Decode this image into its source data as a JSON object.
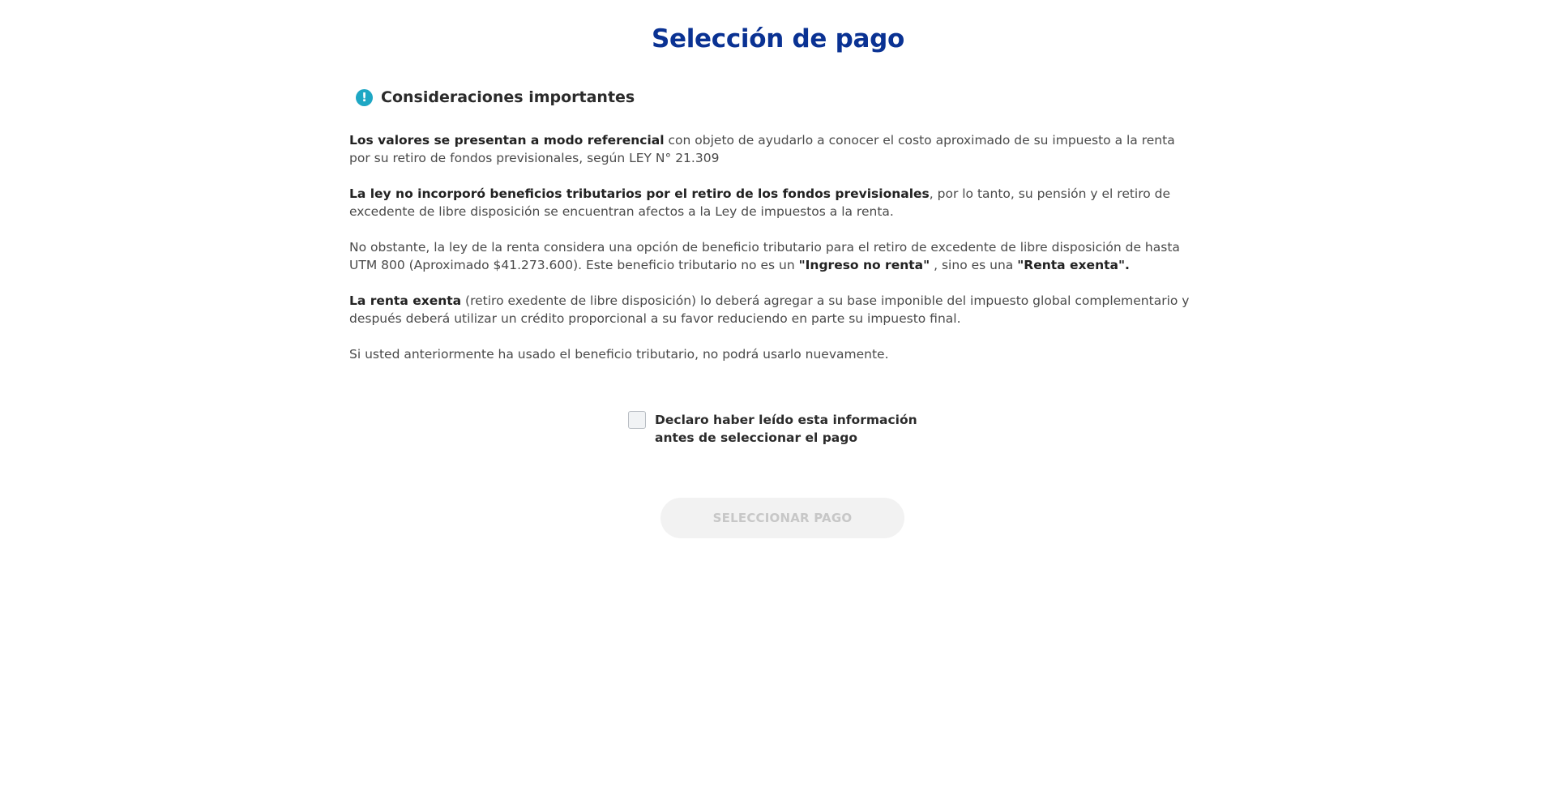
{
  "page": {
    "title": "Selección de pago"
  },
  "notice": {
    "icon": "info-icon",
    "icon_glyph": "!",
    "title": "Consideraciones importantes",
    "accent_color": "#1ea7c4",
    "paragraphs": [
      {
        "bold_1": "Los valores se presentan a modo referencial",
        "text_1": " con objeto de ayudarlo a conocer el costo aproximado de su impuesto a la renta por su retiro de fondos previsionales, según LEY N° 21.309"
      },
      {
        "bold_1": "La ley no incorporó beneficios tributarios por el retiro de los fondos previsionales",
        "text_1": ", por lo tanto, su pensión y el retiro de excedente de libre disposición se encuentran afectos a la Ley de impuestos a la renta."
      },
      {
        "text_1": "No obstante, la ley de la renta considera una opción de beneficio tributario para el retiro de excedente de libre disposición de hasta UTM 800 (Aproximado $41.273.600). Este beneficio tributario no es un ",
        "bold_1": "\"Ingreso no renta\"",
        "text_2": " , sino es una ",
        "bold_2": "\"Renta exenta\"."
      },
      {
        "bold_1": "La renta exenta",
        "text_1": " (retiro exedente de libre disposición) lo deberá agregar a su base imponible del impuesto global complementario y después deberá utilizar un crédito proporcional a su favor reduciendo en parte su impuesto final."
      },
      {
        "text_1": "Si usted anteriormente ha usado el beneficio tributario, no podrá usarlo nuevamente."
      }
    ]
  },
  "declaration": {
    "checked": false,
    "label": "Declaro haber leído esta información antes de seleccionar el pago"
  },
  "actions": {
    "select_payment_label": "SELECCIONAR PAGO",
    "disabled": true
  },
  "colors": {
    "title": "#0a3293",
    "text": "#4a4a4a",
    "button_bg_disabled": "#f2f2f2",
    "button_text_disabled": "#c7c7c7"
  }
}
